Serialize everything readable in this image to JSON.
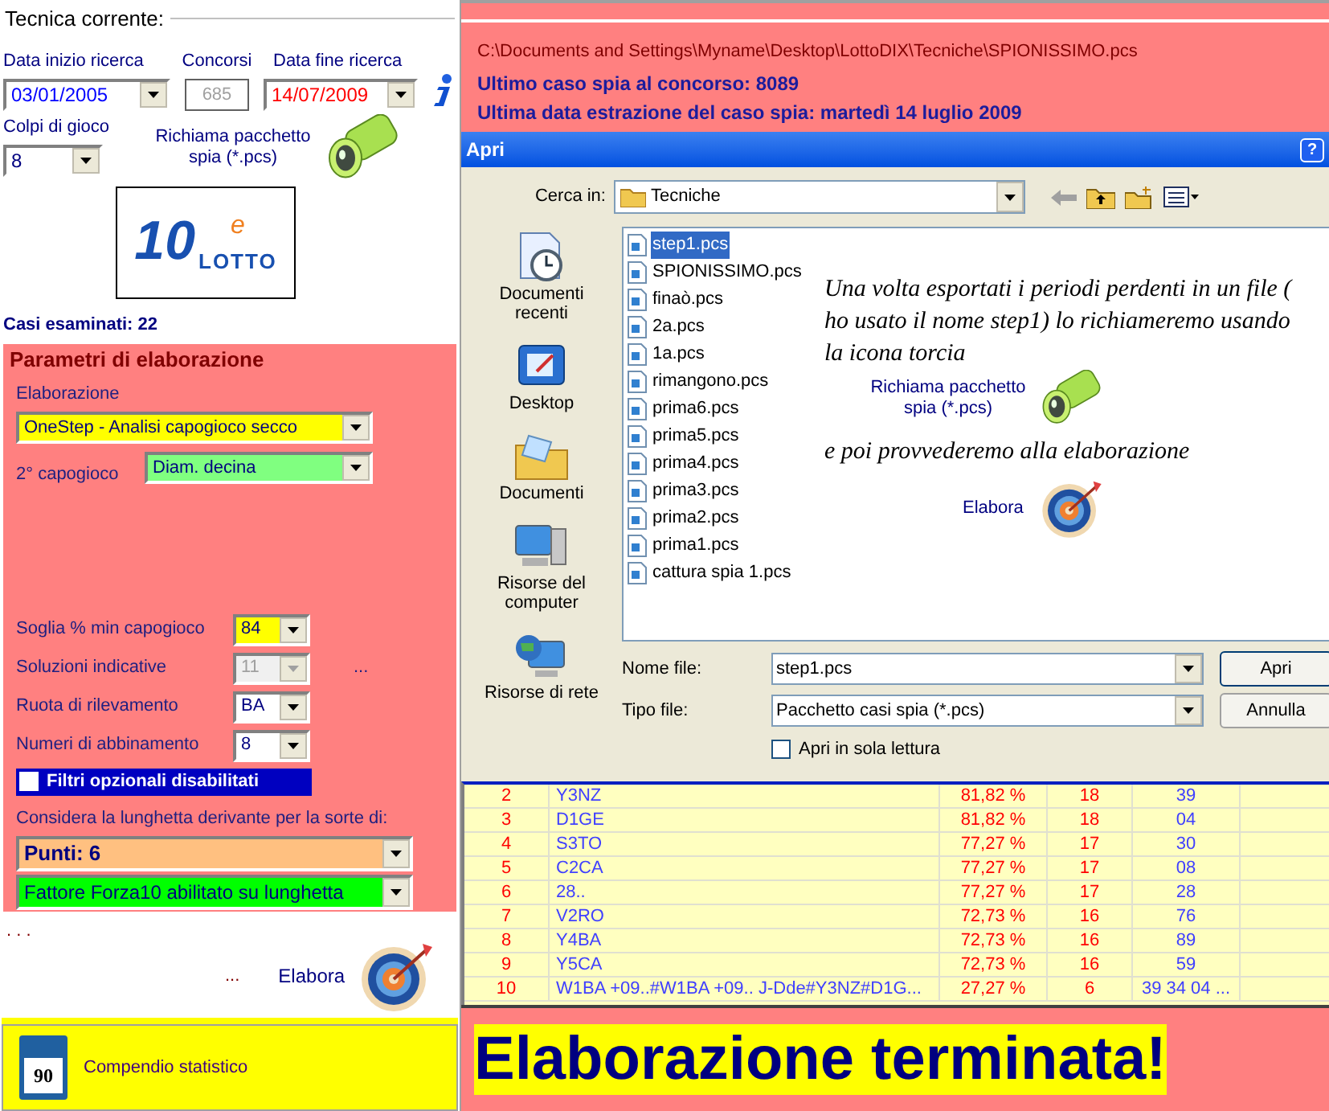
{
  "technique": {
    "title": "Tecnica corrente:",
    "start_date": {
      "label": "Data inizio ricerca",
      "value": "03/01/2005"
    },
    "draws": {
      "label": "Concorsi",
      "value": "685"
    },
    "end_date": {
      "label": "Data fine ricerca",
      "value": "14/07/2009"
    },
    "plays": {
      "label": "Colpi di gioco",
      "value": "8"
    },
    "load_label": "Richiama pacchetto spia (*.pcs)",
    "logo": {
      "number": "10",
      "letter": "e",
      "word": "LOTTO"
    },
    "cases": "Casi esaminati: 22"
  },
  "params": {
    "title": "Parametri di elaborazione",
    "processing_label": "Elaborazione",
    "processing": "OneStep - Analisi capogioco secco",
    "second_label": "2° capogioco",
    "second": "Diam. decina",
    "fields": [
      {
        "label": "Soglia % min capogioco",
        "value": "84",
        "disabled": false,
        "highlight": true
      },
      {
        "label": "Soluzioni indicative",
        "value": "11",
        "disabled": true,
        "highlight": false,
        "extra": "..."
      },
      {
        "label": "Ruota di rilevamento",
        "value": "BA",
        "disabled": false,
        "highlight": false
      },
      {
        "label": "Numeri di abbinamento",
        "value": "8",
        "disabled": false,
        "highlight": false
      }
    ],
    "filters": {
      "label": "Filtri opzionali disabilitati",
      "checked": false
    },
    "sort_label": "Considera la lunghetta derivante per la sorte di:",
    "sort": "Punti: 6",
    "factor": "Fattore Forza10 abilitato su lunghetta"
  },
  "run": {
    "dots": ". . .",
    "ellipsis": "...",
    "label": "Elabora"
  },
  "summary": {
    "icon_number": "90",
    "label": "Compendio statistico"
  },
  "header": {
    "path": "C:\\Documents and Settings\\Myname\\Desktop\\LottoDIX\\Tecniche\\SPIONISSIMO.pcs",
    "last_case": "Ultimo caso spia al concorso:  8089",
    "last_date": "Ultima data estrazione del caso spia: martedì 14 luglio 2009"
  },
  "dialog": {
    "title": "Apri",
    "help": "?",
    "look_in_label": "Cerca in:",
    "folder": "Tecniche",
    "places": [
      {
        "label": "Documenti recenti",
        "kind": "recent"
      },
      {
        "label": "Desktop",
        "kind": "desktop"
      },
      {
        "label": "Documenti",
        "kind": "documents"
      },
      {
        "label": "Risorse del computer",
        "kind": "computer"
      },
      {
        "label": "Risorse di rete",
        "kind": "network"
      }
    ],
    "files": [
      {
        "name": "step1.pcs",
        "selected": true
      },
      {
        "name": "SPIONISSIMO.pcs",
        "selected": false
      },
      {
        "name": "finaò.pcs",
        "selected": false
      },
      {
        "name": "2a.pcs",
        "selected": false
      },
      {
        "name": "1a.pcs",
        "selected": false
      },
      {
        "name": "rimangono.pcs",
        "selected": false
      },
      {
        "name": "prima6.pcs",
        "selected": false
      },
      {
        "name": "prima5.pcs",
        "selected": false
      },
      {
        "name": "prima4.pcs",
        "selected": false
      },
      {
        "name": "prima3.pcs",
        "selected": false
      },
      {
        "name": "prima2.pcs",
        "selected": false
      },
      {
        "name": "prima1.pcs",
        "selected": false
      },
      {
        "name": "cattura spia 1.pcs",
        "selected": false
      }
    ],
    "note": {
      "text1": "Una volta esportati i periodi perdenti in un file ( ho usato il nome step1) lo richiameremo usando la icona torcia",
      "load_label": "Richiama pacchetto spia (*.pcs)",
      "text2": "e poi provvederemo alla elaborazione",
      "run_label": "Elabora"
    },
    "filename_label": "Nome file:",
    "filename": "step1.pcs",
    "filetype_label": "Tipo file:",
    "filetype": "Pacchetto casi spia (*.pcs)",
    "buttons": [
      "Apri",
      "Annulla"
    ],
    "readonly": {
      "label": "Apri in sola lettura",
      "checked": false
    }
  },
  "table": {
    "rows": [
      [
        "2",
        "Y3NZ",
        "81,82 %",
        "18",
        "39"
      ],
      [
        "3",
        "D1GE",
        "81,82 %",
        "18",
        "04"
      ],
      [
        "4",
        "S3TO",
        "77,27 %",
        "17",
        "30"
      ],
      [
        "5",
        "C2CA",
        "77,27 %",
        "17",
        "08"
      ],
      [
        "6",
        "28..",
        "77,27 %",
        "17",
        "28"
      ],
      [
        "7",
        "V2RO",
        "72,73 %",
        "16",
        "76"
      ],
      [
        "8",
        "Y4BA",
        "72,73 %",
        "16",
        "89"
      ],
      [
        "9",
        "Y5CA",
        "72,73 %",
        "16",
        "59"
      ],
      [
        "10",
        "W1BA +09..#W1BA +09.. J-Dde#Y3NZ#D1G...",
        "27,27 %",
        "6",
        "39 34 04 ..."
      ]
    ]
  },
  "status": "Elaborazione terminata!"
}
